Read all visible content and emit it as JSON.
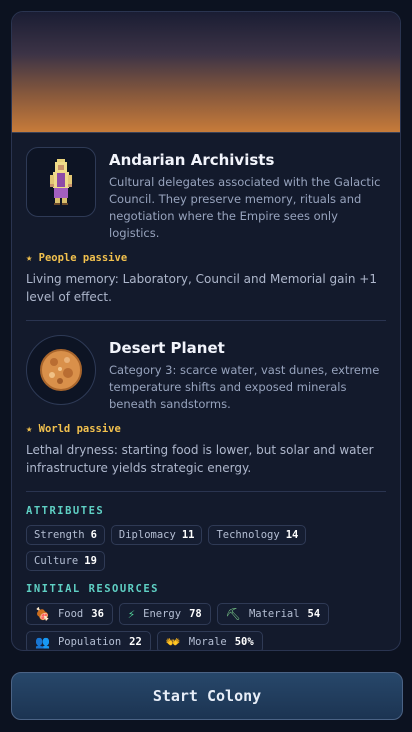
{
  "species": {
    "name": "Andarian Archivists",
    "description": "Cultural delegates associated with the Galactic Council. They preserve memory, rituals and negotiation where the Empire sees only logistics.",
    "passive_title": "★ People passive",
    "passive_text": "Living memory: Laboratory, Council and Memorial gain +1 level of effect.",
    "portrait_icon": "robed-archivist-sprite"
  },
  "planet": {
    "name": "Desert Planet",
    "description": "Category 3: scarce water, vast dunes, extreme temperature shifts and exposed minerals beneath sandstorms.",
    "passive_title": "★ World passive",
    "passive_text": "Lethal dryness: starting food is lower, but solar and water infrastructure yields strategic energy.",
    "planet_icon": "desert-planet-sprite"
  },
  "attributes": {
    "label": "ATTRIBUTES",
    "items": [
      {
        "name": "Strength",
        "value": "6"
      },
      {
        "name": "Diplomacy",
        "value": "11"
      },
      {
        "name": "Technology",
        "value": "14"
      },
      {
        "name": "Culture",
        "value": "19"
      }
    ]
  },
  "resources": {
    "label": "INITIAL RESOURCES",
    "items": [
      {
        "name": "Food",
        "value": "36",
        "icon": "food-icon"
      },
      {
        "name": "Energy",
        "value": "78",
        "icon": "energy-icon"
      },
      {
        "name": "Material",
        "value": "54",
        "icon": "material-icon"
      },
      {
        "name": "Population",
        "value": "22",
        "icon": "population-icon"
      },
      {
        "name": "Morale",
        "value": "50%",
        "icon": "morale-icon"
      }
    ]
  },
  "start_button": "Start Colony",
  "colors": {
    "accent_teal": "#5fd0c4",
    "passive_gold": "#f2c14e",
    "banner_bottom": "#c77b3a"
  }
}
